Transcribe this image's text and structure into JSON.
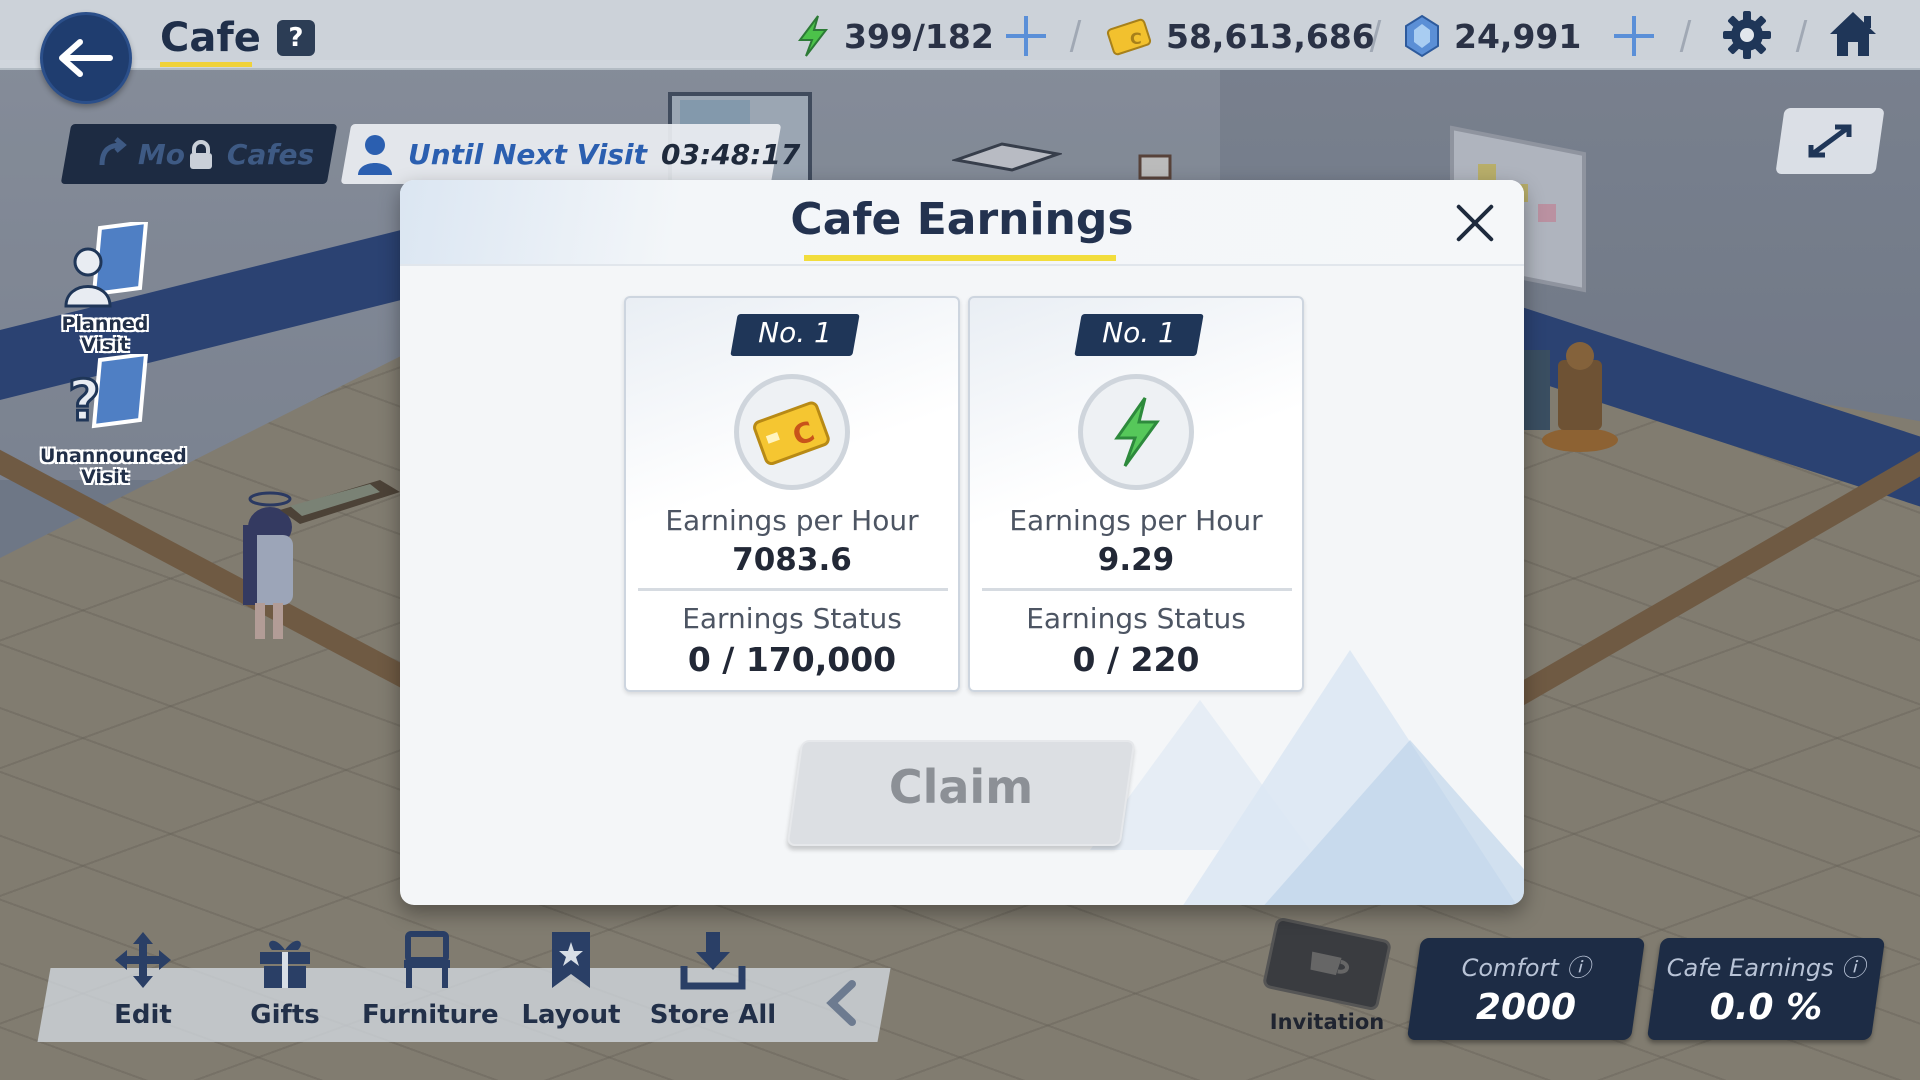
{
  "header": {
    "title": "Cafe",
    "help_label": "?",
    "stamina": "399/182",
    "credits": "58,613,686",
    "pyroxene": "24,991"
  },
  "left_panel": {
    "more_cafes_label": "Mo",
    "more_cafes_label_tail": "Cafes",
    "until_next_visit_label": "Until Next Visit",
    "until_next_visit_time": "03:48:17",
    "planned_visit_label": "Planned Visit",
    "unannounced_visit_label": "Unannounced Visit"
  },
  "toolbar": {
    "items": [
      {
        "label": "Edit",
        "icon": "move-arrows-icon"
      },
      {
        "label": "Gifts",
        "icon": "gift-icon"
      },
      {
        "label": "Furniture",
        "icon": "chair-icon"
      },
      {
        "label": "Layout",
        "icon": "bookmark-icon"
      },
      {
        "label": "Store All",
        "icon": "download-icon"
      }
    ],
    "invitation_label": "Invitation"
  },
  "stats": {
    "comfort_label": "Comfort",
    "comfort_value": "2000",
    "cafe_earnings_label": "Cafe Earnings",
    "cafe_earnings_value": "0.0 %"
  },
  "modal": {
    "title": "Cafe Earnings",
    "cards": [
      {
        "rank": "No. 1",
        "icon": "credit-card-icon",
        "rate_label": "Earnings per Hour",
        "rate_value": "7083.6",
        "status_label": "Earnings Status",
        "status_value": "0 / 170,000"
      },
      {
        "rank": "No. 1",
        "icon": "lightning-bolt-icon",
        "rate_label": "Earnings per Hour",
        "rate_value": "9.29",
        "status_label": "Earnings Status",
        "status_value": "0 / 220"
      }
    ],
    "claim_label": "Claim"
  },
  "colors": {
    "navy": "#1f3658",
    "accent_yellow": "#f2dd3d",
    "link_blue": "#2b5fb0"
  }
}
